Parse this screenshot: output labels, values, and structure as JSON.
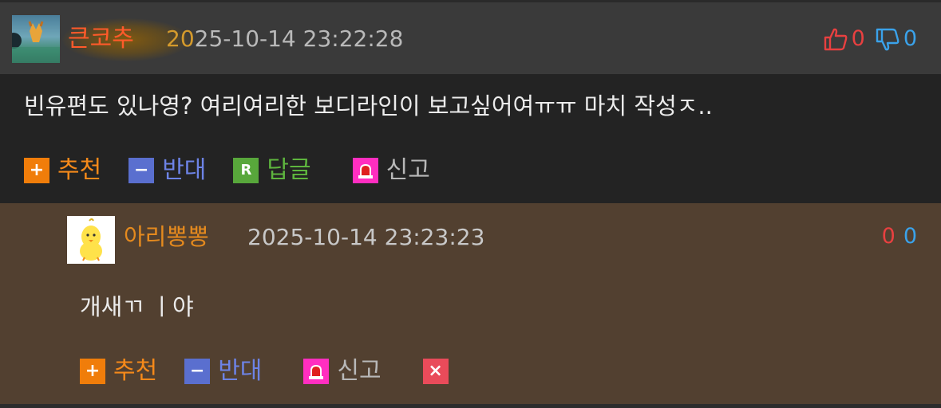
{
  "comment": {
    "nickname": "큰코추",
    "date_prefix": "20",
    "date_rest": "25-10-14 23:22:28",
    "upvotes": "0",
    "downvotes": "0",
    "body": "빈유편도 있나영? 여리여리한 보디라인이 보고싶어여ㅠㅠ 마치 작성ㅈ..",
    "actions": {
      "recommend": "추천",
      "oppose": "반대",
      "reply": "답글",
      "report": "신고"
    },
    "icons": {
      "recommend": "+",
      "oppose": "−",
      "reply": "R"
    }
  },
  "reply": {
    "nickname": "아리뽕뽕",
    "date": "2025-10-14 23:23:23",
    "upvotes": "0",
    "downvotes": "0",
    "body": "개새ㄲ ㅣ야",
    "actions": {
      "recommend": "추천",
      "oppose": "반대",
      "report": "신고"
    },
    "icons": {
      "recommend": "+",
      "oppose": "−",
      "delete": "×"
    }
  },
  "colors": {
    "upvote": "#e84040",
    "downvote": "#3aa2ea",
    "top_nickname": "#ff5a2a",
    "reply_nickname": "#e58a1e",
    "reply_background": "#524030"
  }
}
